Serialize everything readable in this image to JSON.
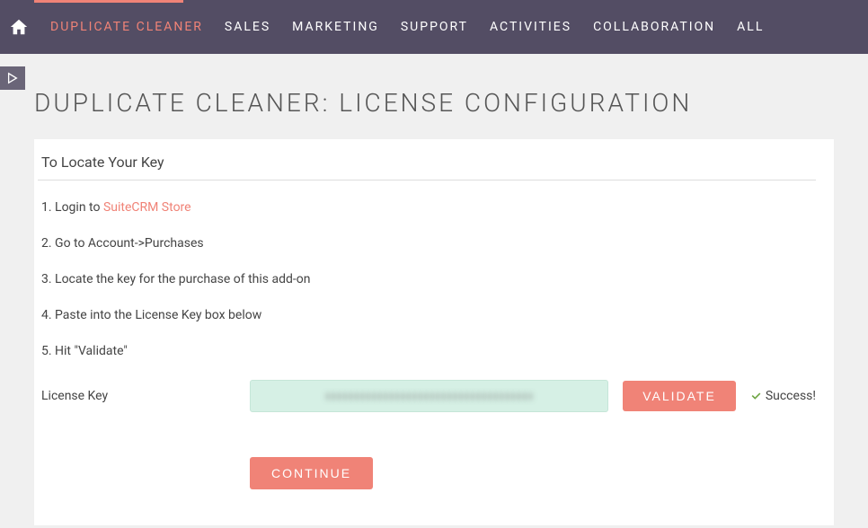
{
  "nav": {
    "items": [
      {
        "label": "Duplicate Cleaner",
        "active": true
      },
      {
        "label": "Sales"
      },
      {
        "label": "Marketing"
      },
      {
        "label": "Support"
      },
      {
        "label": "Activities"
      },
      {
        "label": "Collaboration"
      },
      {
        "label": "All"
      }
    ]
  },
  "page": {
    "title": "Duplicate Cleaner: License Configuration"
  },
  "section": {
    "title": "To Locate Your Key"
  },
  "steps": {
    "s1_prefix": "1. Login to ",
    "s1_link": "SuiteCRM Store",
    "s2": "2. Go to Account->Purchases",
    "s3": "3. Locate the key for the purchase of this add-on",
    "s4": "4. Paste into the License Key box below",
    "s5": "5. Hit \"Validate\""
  },
  "license": {
    "label": "License Key",
    "value": "xxxxxxxxxxxxxxxxxxxxxxxxxxxxxxxxxxxx",
    "validate_label": "Validate",
    "success_label": "Success!"
  },
  "continue": {
    "label": "Continue"
  }
}
